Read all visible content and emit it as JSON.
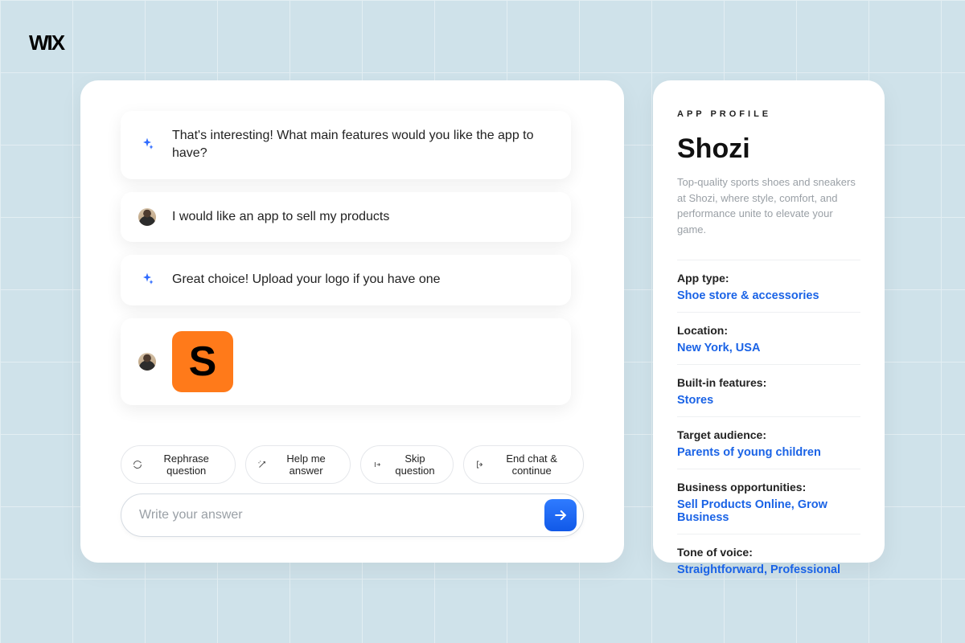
{
  "brand": {
    "name": "WIX"
  },
  "chat": {
    "messages": [
      {
        "role": "ai",
        "text": "That's interesting! What main features would you like the app to have?"
      },
      {
        "role": "user",
        "text": "I would like an app to sell my products"
      },
      {
        "role": "ai",
        "text": "Great choice!  Upload your logo if you have one"
      },
      {
        "role": "user-logo",
        "logo_letter": "S"
      }
    ],
    "actions": {
      "rephrase": "Rephrase question",
      "help": "Help me answer",
      "skip": "Skip question",
      "end": "End chat & continue"
    },
    "composer": {
      "placeholder": "Write your answer"
    }
  },
  "profile": {
    "label": "APP PROFILE",
    "title": "Shozi",
    "description": "Top-quality sports shoes and sneakers at Shozi, where style, comfort, and performance unite to elevate your game.",
    "fields": [
      {
        "key": "App type:",
        "value": "Shoe store & accessories"
      },
      {
        "key": "Location:",
        "value": "New York, USA"
      },
      {
        "key": "Built-in features:",
        "value": "Stores"
      },
      {
        "key": "Target audience:",
        "value": "Parents of young children"
      },
      {
        "key": "Business opportunities:",
        "value": "Sell Products Online, Grow Business"
      },
      {
        "key": "Tone of voice:",
        "value": "Straightforward, Professional"
      }
    ]
  }
}
